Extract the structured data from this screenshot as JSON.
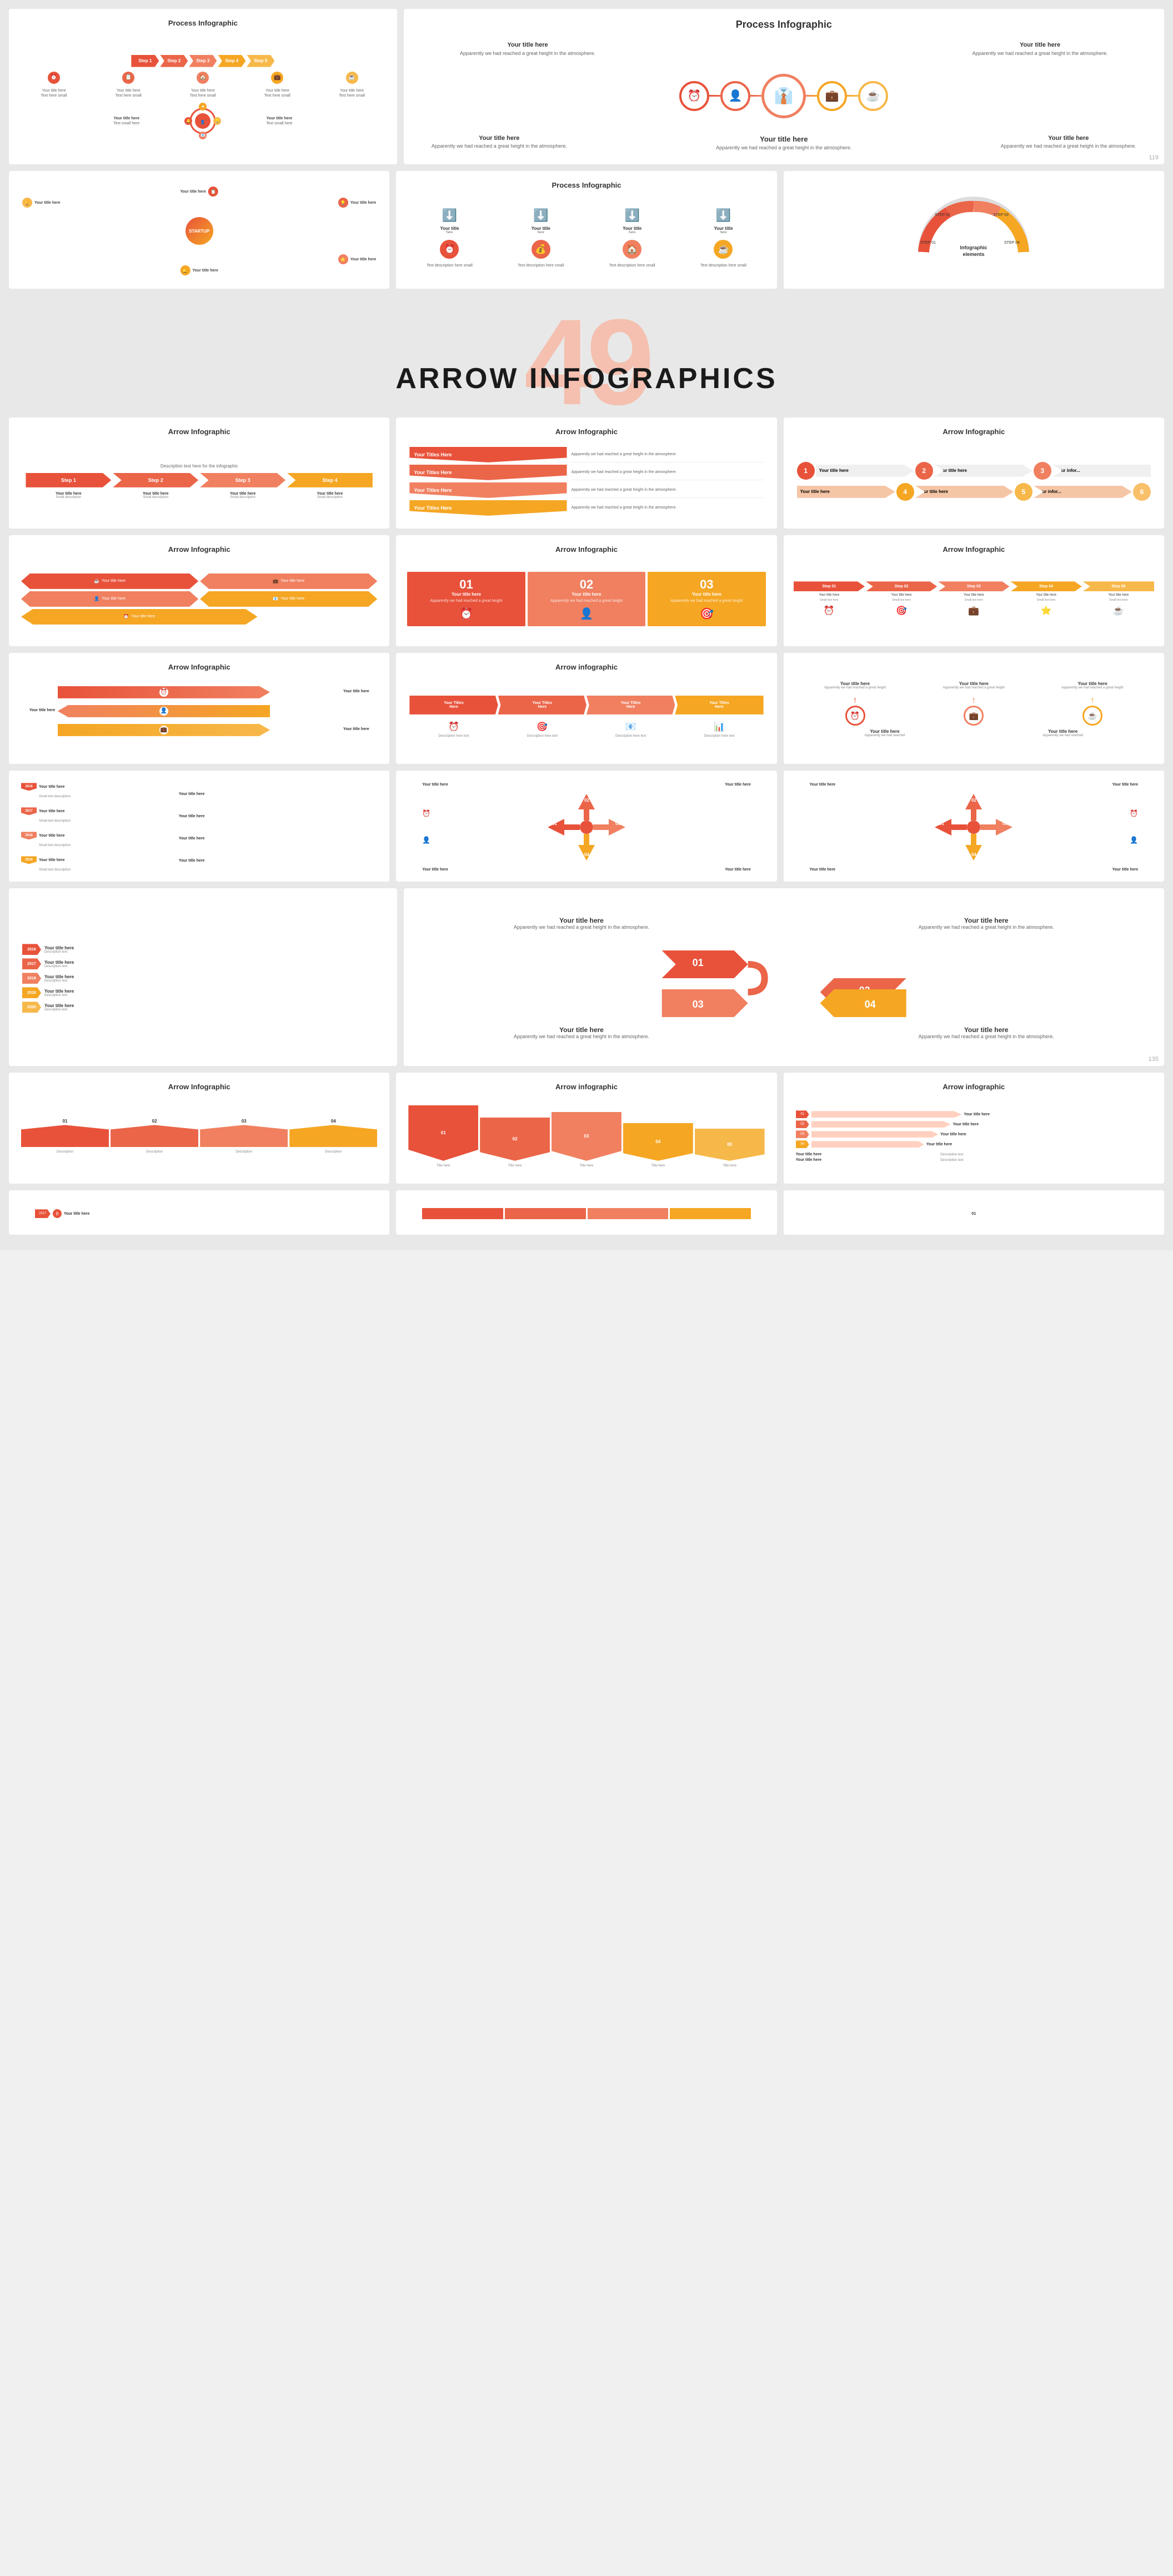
{
  "page": {
    "background": "#e8e8e8"
  },
  "process_section": {
    "slides_row1": [
      {
        "title": "Process Infographic",
        "type": "steps_horizontal",
        "num": null
      },
      {
        "title": "Process Infographic",
        "type": "circle_process",
        "num": "119"
      }
    ],
    "slides_row2": [
      {
        "title": null,
        "type": "startup_circle",
        "num": null
      },
      {
        "title": "Process Infographic",
        "type": "icon_steps",
        "num": null
      },
      {
        "title": null,
        "type": "semicircle_steps",
        "num": null
      }
    ]
  },
  "arrow_section": {
    "banner_num": "49",
    "banner_title": "ARROW INFOGRAPHICS",
    "slides": [
      {
        "title": "Arrow Infographic",
        "type": "arrow_steps_4",
        "num": null
      },
      {
        "title": "Arrow Infographic",
        "type": "arrow_bookmarks",
        "num": null
      },
      {
        "title": "Arrow Infographic",
        "type": "arrow_numbered",
        "num": null
      },
      {
        "title": "Arrow Infographic",
        "type": "arrow_hexagon",
        "num": null
      },
      {
        "title": "Arrow Infographic",
        "type": "arrow_numbered_large",
        "num": null
      },
      {
        "title": "Arrow Infographic",
        "type": "arrow_table",
        "num": null
      },
      {
        "title": "Arrow Infographic",
        "type": "arrow_snake",
        "num": null
      },
      {
        "title": "Arrow infographic",
        "type": "arrow_wide",
        "num": null
      },
      {
        "title": null,
        "type": "arrow_circles_row",
        "num": null
      },
      {
        "title": null,
        "type": "arrow_diamond_1",
        "num": null
      },
      {
        "title": null,
        "type": "arrow_diamond_2",
        "num": null
      },
      {
        "title": null,
        "type": "arrow_diamond_3",
        "num": null
      },
      {
        "title": null,
        "type": "arrow_timeline_left",
        "num": null
      },
      {
        "title": null,
        "type": "arrow_timeline_left2",
        "num": null
      },
      {
        "title": null,
        "type": "arrow_snake_large",
        "num": "135"
      },
      {
        "title": "Arrow Infographic",
        "type": "arrow_mountain_1",
        "num": null
      },
      {
        "title": "Arrow infographic",
        "type": "arrow_mountain_2",
        "num": null
      },
      {
        "title": "Arrow infographic",
        "type": "arrow_fan",
        "num": null
      }
    ]
  },
  "labels": {
    "your_title": "Your title here",
    "apparently": "Apparently we had reached a great height in the atmosphere.",
    "step1": "Step 1",
    "step2": "Step 2",
    "step3": "Step 3",
    "step4": "Step 4",
    "step5": "Step 5",
    "your_titles_here": "Your Titles Here",
    "num_01": "01",
    "num_02": "02",
    "num_03": "03",
    "num_04": "04",
    "startup": "STARTUP"
  },
  "colors": {
    "red": "#e8523a",
    "orange": "#f5a623",
    "red_light": "#f27c5f",
    "orange_light": "#f9c06a",
    "gray_bg": "#f5f5f5",
    "dark": "#333333"
  }
}
